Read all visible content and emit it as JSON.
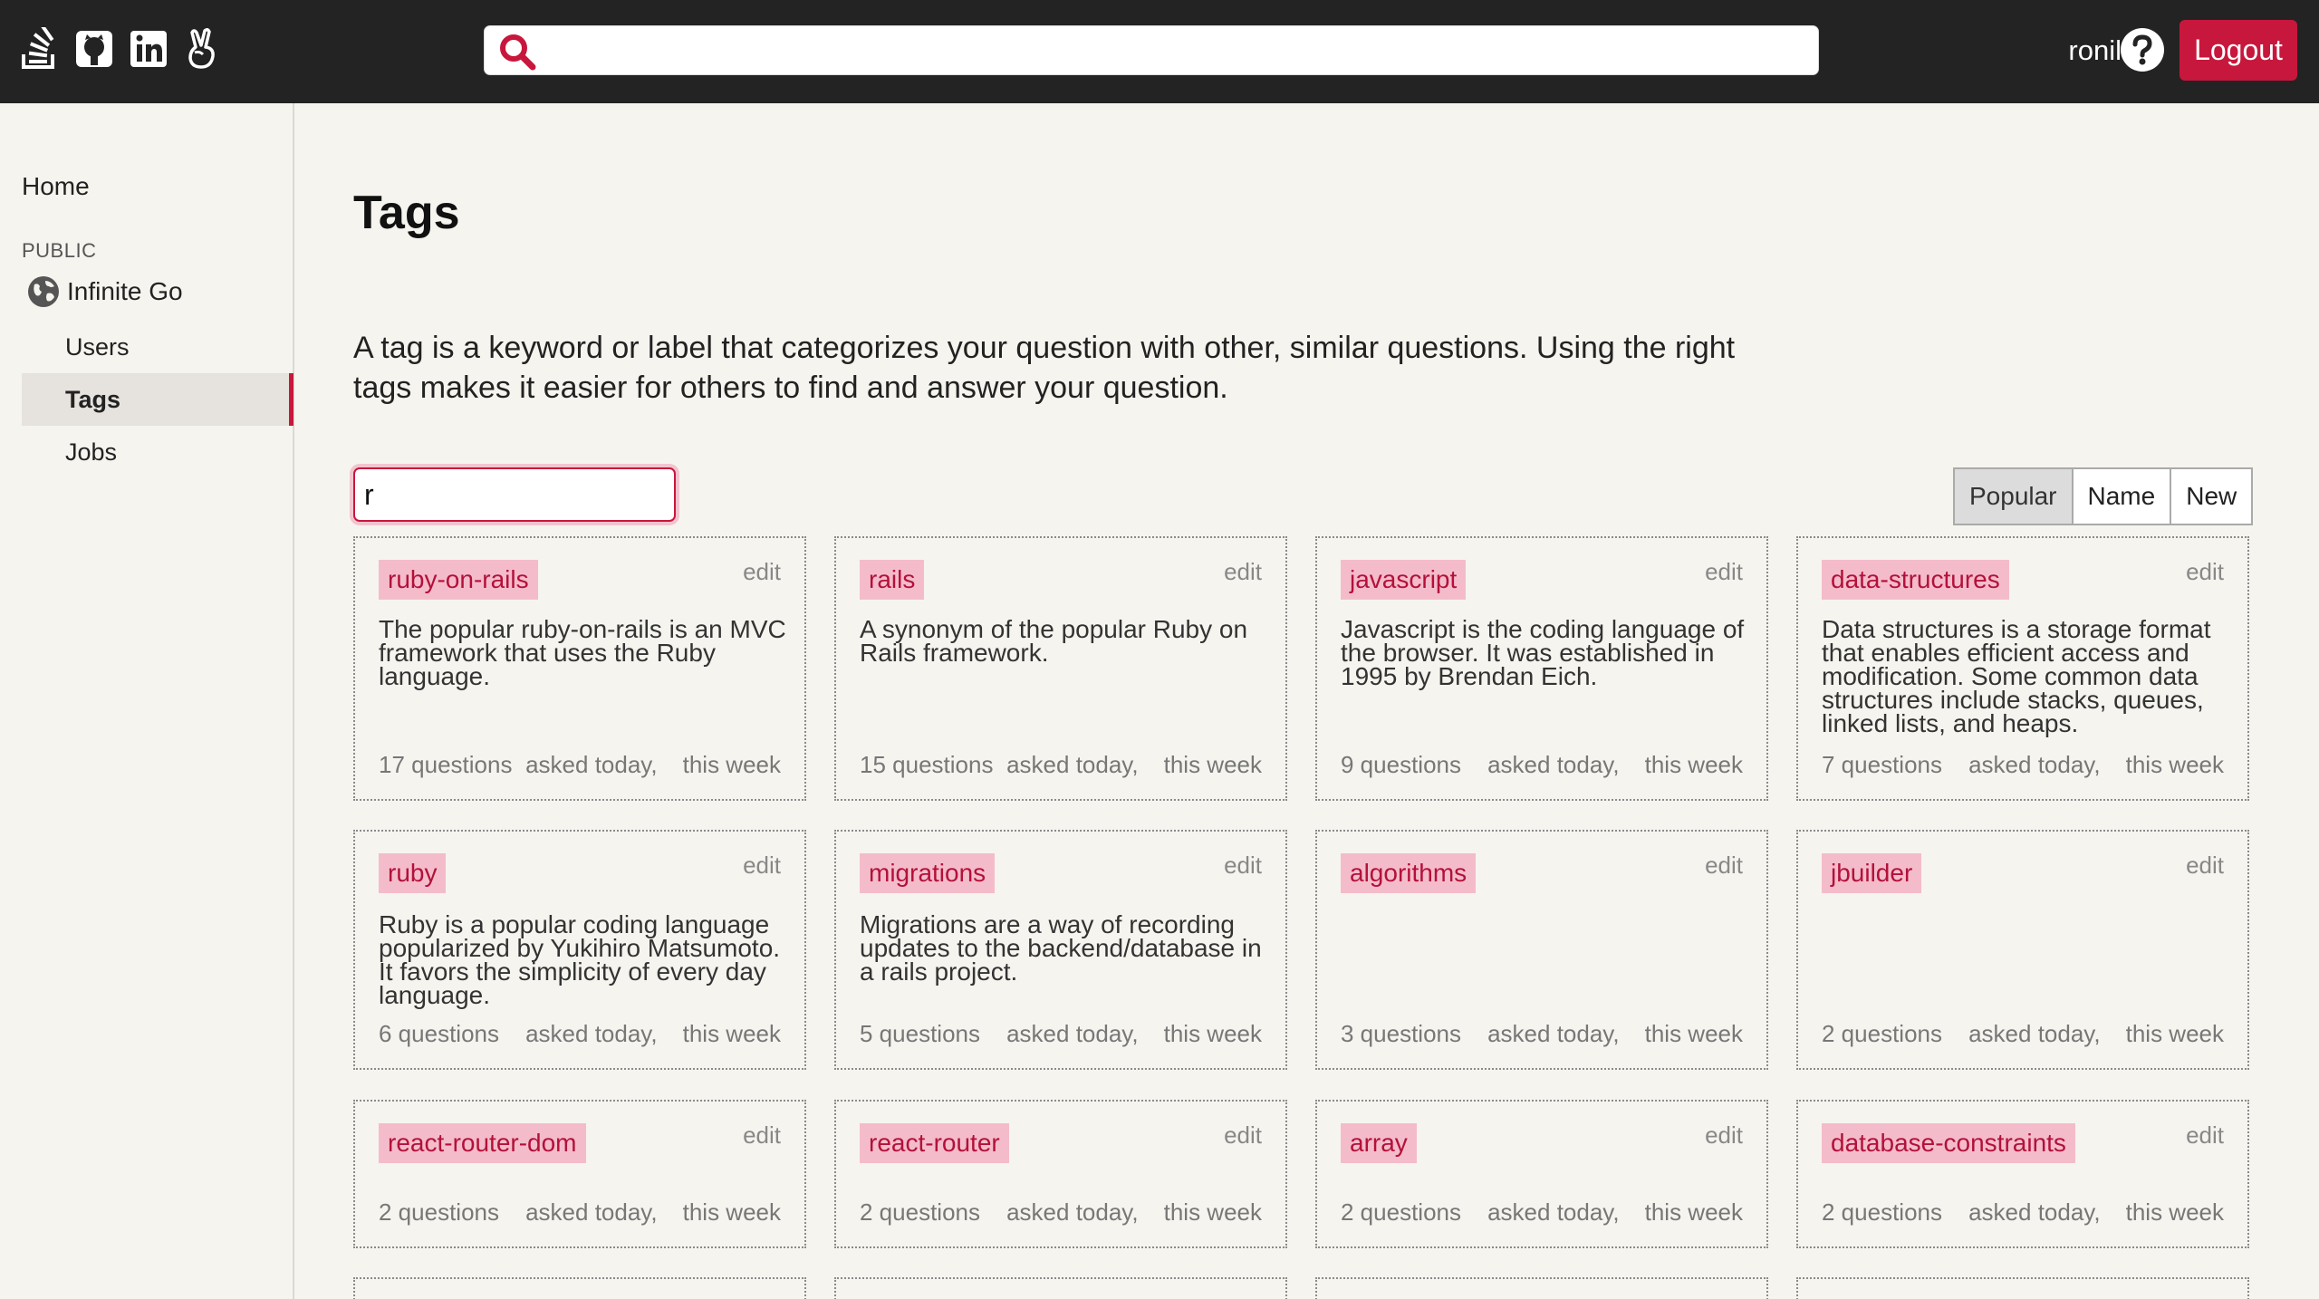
{
  "topbar": {
    "icons": [
      "stack-overflow-icon",
      "github-icon",
      "linkedin-icon",
      "angellist-icon"
    ],
    "search_placeholder": "",
    "username": "ronil",
    "logout_label": "Logout"
  },
  "sidebar": {
    "home": "Home",
    "section_label": "PUBLIC",
    "site_name": "Infinite Go",
    "items": [
      {
        "label": "Users",
        "active": false
      },
      {
        "label": "Tags",
        "active": true
      },
      {
        "label": "Jobs",
        "active": false
      }
    ]
  },
  "main": {
    "title": "Tags",
    "intro": "A tag is a keyword or label that categorizes your question with other, similar questions. Using the right tags makes it easier for others to find and answer your question.",
    "filter_value": "r",
    "sort_options": [
      "Popular",
      "Name",
      "New"
    ],
    "sort_active": "Popular",
    "edit_label": "edit",
    "cards": [
      {
        "tag": "ruby-on-rails",
        "desc": "The popular ruby-on-rails is an MVC framework that uses the Ruby language.",
        "count": "17 questions",
        "asked": "asked today,",
        "week": "this week"
      },
      {
        "tag": "rails",
        "desc": "A synonym of the popular Ruby on Rails framework.",
        "count": "15 questions",
        "asked": "asked today,",
        "week": "this week"
      },
      {
        "tag": "javascript",
        "desc": "Javascript is the coding language of the browser. It was established in 1995 by Brendan Eich.",
        "count": "9 questions",
        "asked": "asked today,",
        "week": "this week"
      },
      {
        "tag": "data-structures",
        "desc": "Data structures is a storage format that enables efficient access and modification. Some common data structures include stacks, queues, linked lists, and heaps.",
        "count": "7 questions",
        "asked": "asked today,",
        "week": "this week"
      },
      {
        "tag": "ruby",
        "desc": "Ruby is a popular coding language popularized by Yukihiro Matsumoto. It favors the simplicity of every day language.",
        "count": "6 questions",
        "asked": "asked today,",
        "week": "this week"
      },
      {
        "tag": "migrations",
        "desc": "Migrations are a way of recording updates to the backend/database in a rails project.",
        "count": "5 questions",
        "asked": "asked today,",
        "week": "this week"
      },
      {
        "tag": "algorithms",
        "desc": "",
        "count": "3 questions",
        "asked": "asked today,",
        "week": "this week"
      },
      {
        "tag": "jbuilder",
        "desc": "",
        "count": "2 questions",
        "asked": "asked today,",
        "week": "this week"
      },
      {
        "tag": "react-router-dom",
        "desc": "",
        "count": "2 questions",
        "asked": "asked today,",
        "week": "this week"
      },
      {
        "tag": "react-router",
        "desc": "",
        "count": "2 questions",
        "asked": "asked today,",
        "week": "this week"
      },
      {
        "tag": "array",
        "desc": "",
        "count": "2 questions",
        "asked": "asked today,",
        "week": "this week"
      },
      {
        "tag": "database-constraints",
        "desc": "",
        "count": "2 questions",
        "asked": "asked today,",
        "week": "this week"
      }
    ]
  },
  "colors": {
    "accent": "#c8173c",
    "tag_bg": "#f4bccb",
    "topbar_bg": "#232323",
    "page_bg": "#f6f4ef"
  }
}
